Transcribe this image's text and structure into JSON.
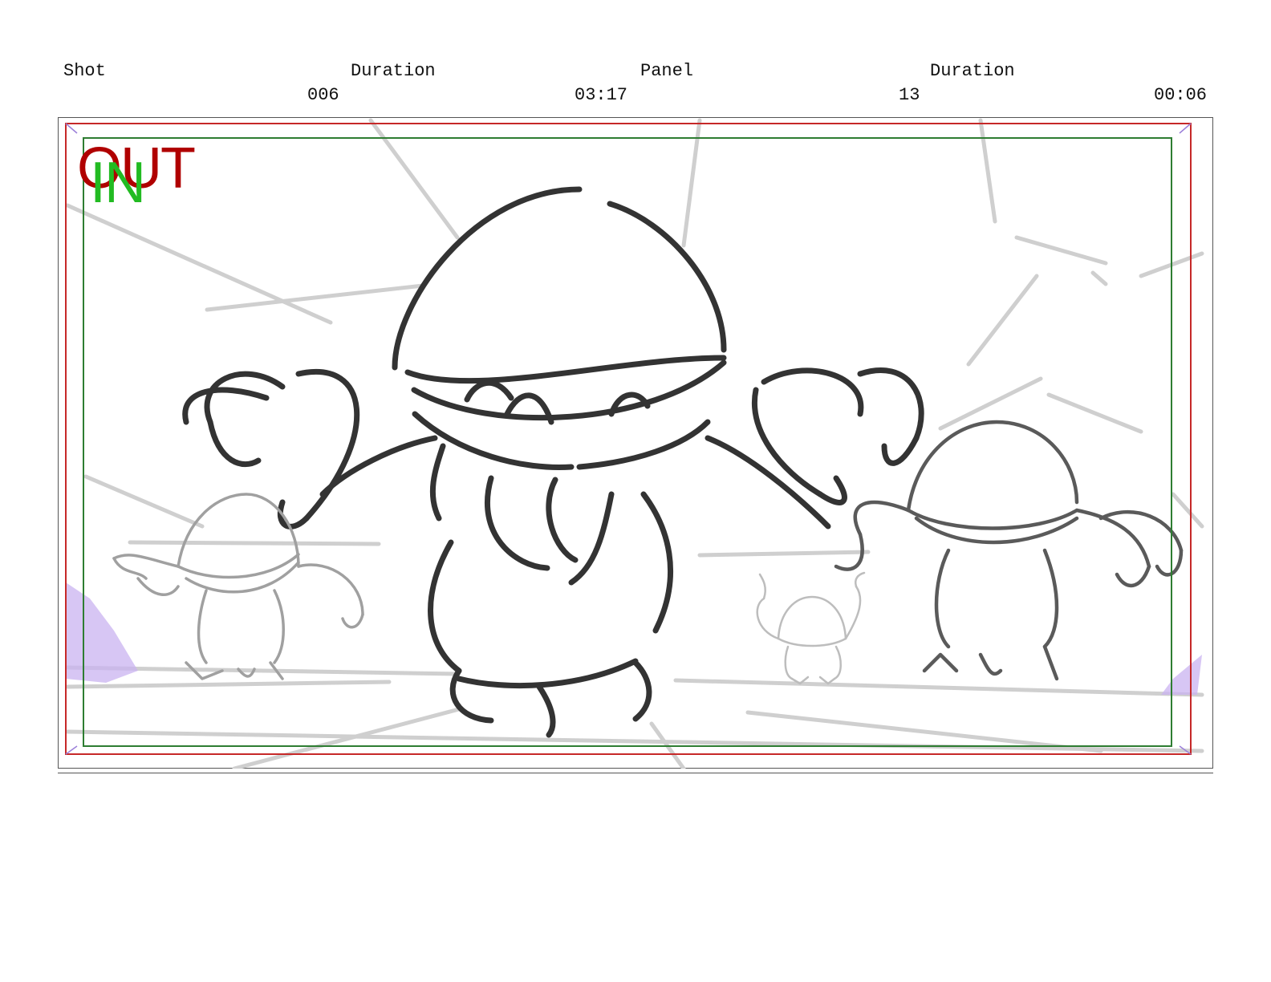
{
  "header": {
    "shot_label": "Shot",
    "duration_label": "Duration",
    "panel_label": "Panel",
    "panel_duration_label": "Duration",
    "shot_value": "006",
    "shot_duration_value": "03:17",
    "panel_value": "13",
    "panel_duration_value": "00:06"
  },
  "panel": {
    "out_tag": "OUT",
    "in_tag": "IN",
    "colors": {
      "out_tag": "#b00000",
      "in_tag": "#22bb22",
      "action_safe": "#2e7d32",
      "frame_edge": "#c62828",
      "camera_corners": "#9b7fd9",
      "sketch_line": "#333333",
      "background_sketch": "#cccccc"
    }
  }
}
